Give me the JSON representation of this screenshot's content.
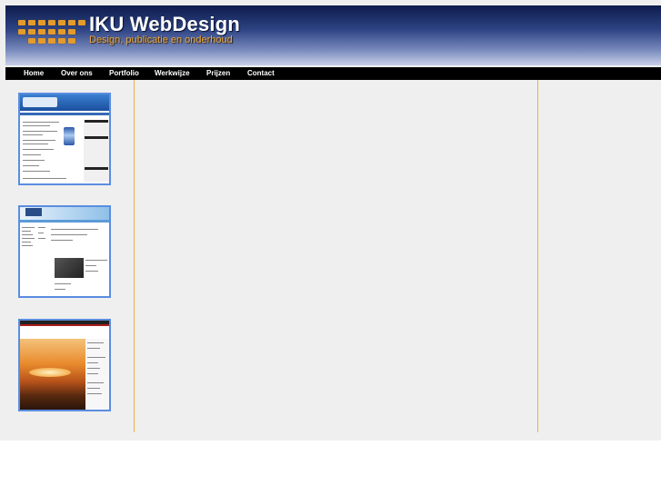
{
  "header": {
    "title": "IKU WebDesign",
    "slogan": "Design, publicatie en onderhoud",
    "logo_icon": "orange-squares-grid-icon"
  },
  "nav": {
    "items": [
      {
        "label": "Home"
      },
      {
        "label": "Over ons"
      },
      {
        "label": "Portfolio"
      },
      {
        "label": "Werkwijze"
      },
      {
        "label": "Prijzen"
      },
      {
        "label": "Contact"
      }
    ]
  },
  "portfolio": {
    "thumbnails": [
      {
        "name": "portfolio-thumbnail-1"
      },
      {
        "name": "portfolio-thumbnail-2"
      },
      {
        "name": "portfolio-thumbnail-3"
      }
    ]
  },
  "colors": {
    "header_dark": "#0e1b4c",
    "accent_orange": "#e39b2b",
    "nav_bg": "#000000",
    "divider": "#e9b04c",
    "thumb_border": "#5a8de0",
    "page_bg": "#efefef"
  }
}
